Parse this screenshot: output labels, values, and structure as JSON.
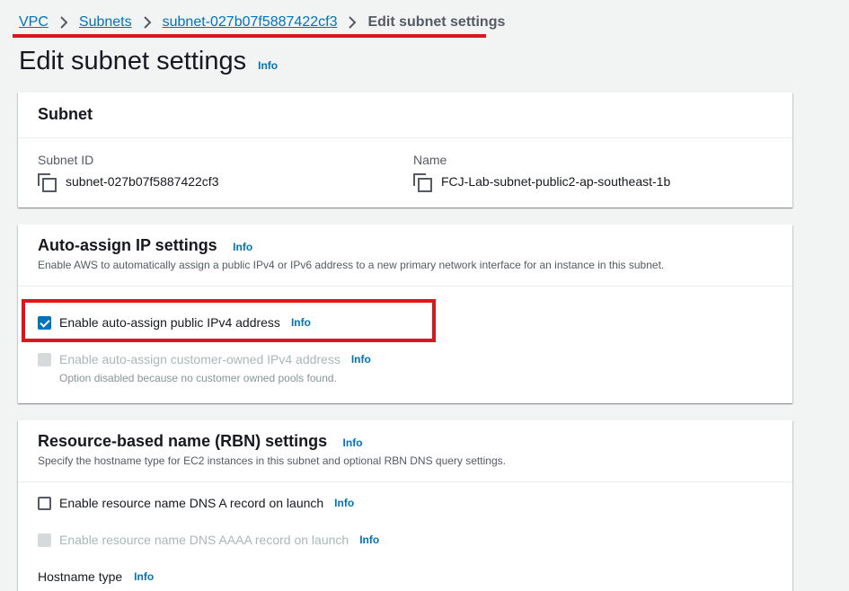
{
  "breadcrumb": {
    "vpc": "VPC",
    "subnets": "Subnets",
    "subnet_id": "subnet-027b07f5887422cf3",
    "current": "Edit subnet settings"
  },
  "page": {
    "title": "Edit subnet settings",
    "info": "Info"
  },
  "subnet_panel": {
    "title": "Subnet",
    "subnet_id_label": "Subnet ID",
    "subnet_id_value": "subnet-027b07f5887422cf3",
    "name_label": "Name",
    "name_value": "FCJ-Lab-subnet-public2-ap-southeast-1b"
  },
  "auto_assign_panel": {
    "title": "Auto-assign IP settings",
    "info": "Info",
    "description": "Enable AWS to automatically assign a public IPv4 or IPv6 address to a new primary network interface for an instance in this subnet.",
    "options": [
      {
        "label": "Enable auto-assign public IPv4 address",
        "info": "Info",
        "checked": true,
        "disabled": false
      },
      {
        "label": "Enable auto-assign customer-owned IPv4 address",
        "info": "Info",
        "checked": false,
        "disabled": true,
        "note": "Option disabled because no customer owned pools found."
      }
    ]
  },
  "rbn_panel": {
    "title": "Resource-based name (RBN) settings",
    "info": "Info",
    "description": "Specify the hostname type for EC2 instances in this subnet and optional RBN DNS query settings.",
    "options": [
      {
        "label": "Enable resource name DNS A record on launch",
        "info": "Info",
        "checked": false,
        "disabled": false
      },
      {
        "label": "Enable resource name DNS AAAA record on launch",
        "info": "Info",
        "checked": false,
        "disabled": true
      }
    ],
    "hostname_type_label": "Hostname type",
    "hostname_type_info": "Info"
  },
  "colors": {
    "link": "#0073bb",
    "annotation": "#e0141e",
    "background": "#f2f3f3"
  }
}
